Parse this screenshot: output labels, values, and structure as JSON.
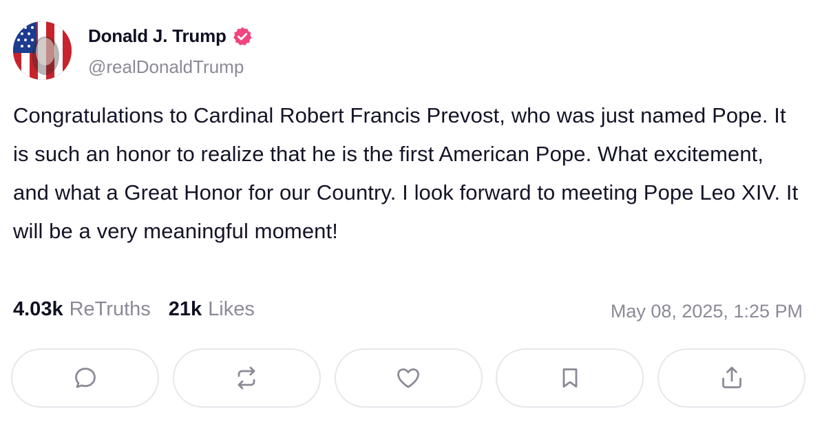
{
  "author": {
    "name": "Donald J. Trump",
    "handle": "@realDonaldTrump",
    "verified": true,
    "verified_color": "#f0457d"
  },
  "post": {
    "text": "Congratulations to Cardinal Robert Francis Prevost, who was just named Pope. It is such an honor to realize that he is the first American Pope. What excitement, and what a Great Honor for our Country. I look forward to meeting Pope Leo XIV. It will be a very meaningful moment!",
    "retruths_count": "4.03k",
    "retruths_label": "ReTruths",
    "likes_count": "21k",
    "likes_label": "Likes",
    "timestamp": "May 08, 2025, 1:25 PM"
  },
  "actions": [
    {
      "name": "reply",
      "icon": "comment-icon"
    },
    {
      "name": "retruth",
      "icon": "repost-icon"
    },
    {
      "name": "like",
      "icon": "heart-icon"
    },
    {
      "name": "bookmark",
      "icon": "bookmark-icon"
    },
    {
      "name": "share",
      "icon": "share-icon"
    }
  ],
  "colors": {
    "text": "#0f0f23",
    "muted": "#8a8a96",
    "icon": "#8a8a96",
    "button_border": "#e6e6ec"
  }
}
